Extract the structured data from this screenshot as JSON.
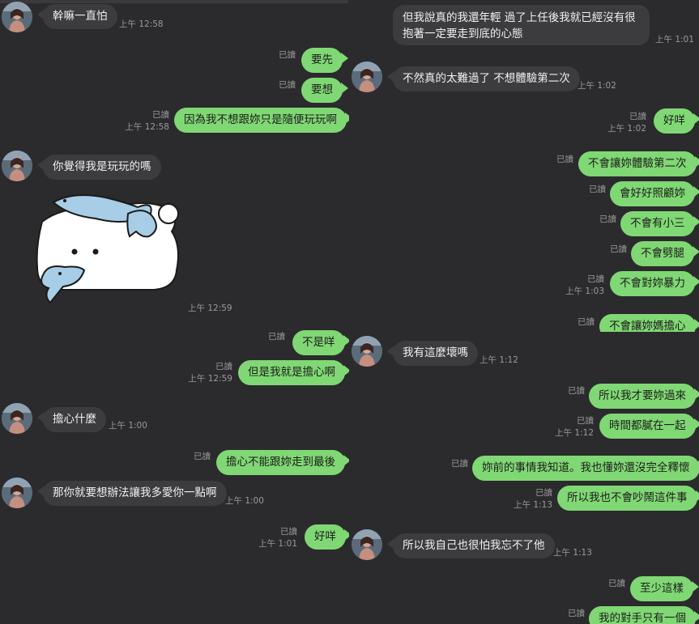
{
  "read_label": "已讀",
  "left": {
    "messages": [
      {
        "text": "幹嘛一直怕",
        "time": "上午 12:58"
      },
      {
        "text": "要先"
      },
      {
        "text": "要想"
      },
      {
        "text": "因為我不想跟妳只是隨便玩玩啊",
        "time": "上午 12:58"
      },
      {
        "text": "你覺得我是玩玩的嗎"
      },
      {
        "time": "上午 12:59"
      },
      {
        "text": "不是咩"
      },
      {
        "text": "但是我就是擔心啊",
        "time": "上午 12:59"
      },
      {
        "text": "擔心什麼",
        "time": "上午 1:00"
      },
      {
        "text": "擔心不能跟妳走到最後"
      },
      {
        "text": "那你就要想辦法讓我多愛你一點啊",
        "time": "上午 1:00"
      },
      {
        "text": "好咩",
        "time": "上午 1:01"
      }
    ]
  },
  "right": {
    "messages": [
      {
        "text": "但我說真的我還年輕 過了上任後我就已經沒有很抱著一定要走到底的心態",
        "time": "上午 1:01"
      },
      {
        "text": "不然真的太難過了 不想體驗第二次",
        "time": "上午 1:02"
      },
      {
        "text": "好咩",
        "time": "上午 1:02"
      },
      {
        "text": "不會讓妳體驗第二次"
      },
      {
        "text": "會好好照顧妳"
      },
      {
        "text": "不會有小三"
      },
      {
        "text": "不會劈腿"
      },
      {
        "text": "不會對妳暴力",
        "time": "上午 1:03"
      },
      {
        "text": "不會讓妳媽擔心"
      },
      {
        "text": "我有這麼壞嗎",
        "time": "上午 1:12"
      },
      {
        "text": "所以我才要妳過來"
      },
      {
        "text": "時間都膩在一起",
        "time": "上午 1:12"
      },
      {
        "text": "妳前的事情我知道。我也懂妳還沒完全釋懷"
      },
      {
        "text": "所以我也不會吵鬧這件事",
        "time": "上午 1:13"
      },
      {
        "text": "所以我自己也很怕我忘不了他",
        "time": "上午 1:13"
      },
      {
        "text": "至少這樣"
      },
      {
        "text": "我的對手只有一個"
      }
    ]
  },
  "colors": {
    "background": "#2b2b2d",
    "incoming_bubble": "#3c3c3e",
    "outgoing_bubble": "#80d874"
  },
  "icons": {
    "avatar": "avatar-photo",
    "sticker": "cat-with-fish-sticker"
  }
}
